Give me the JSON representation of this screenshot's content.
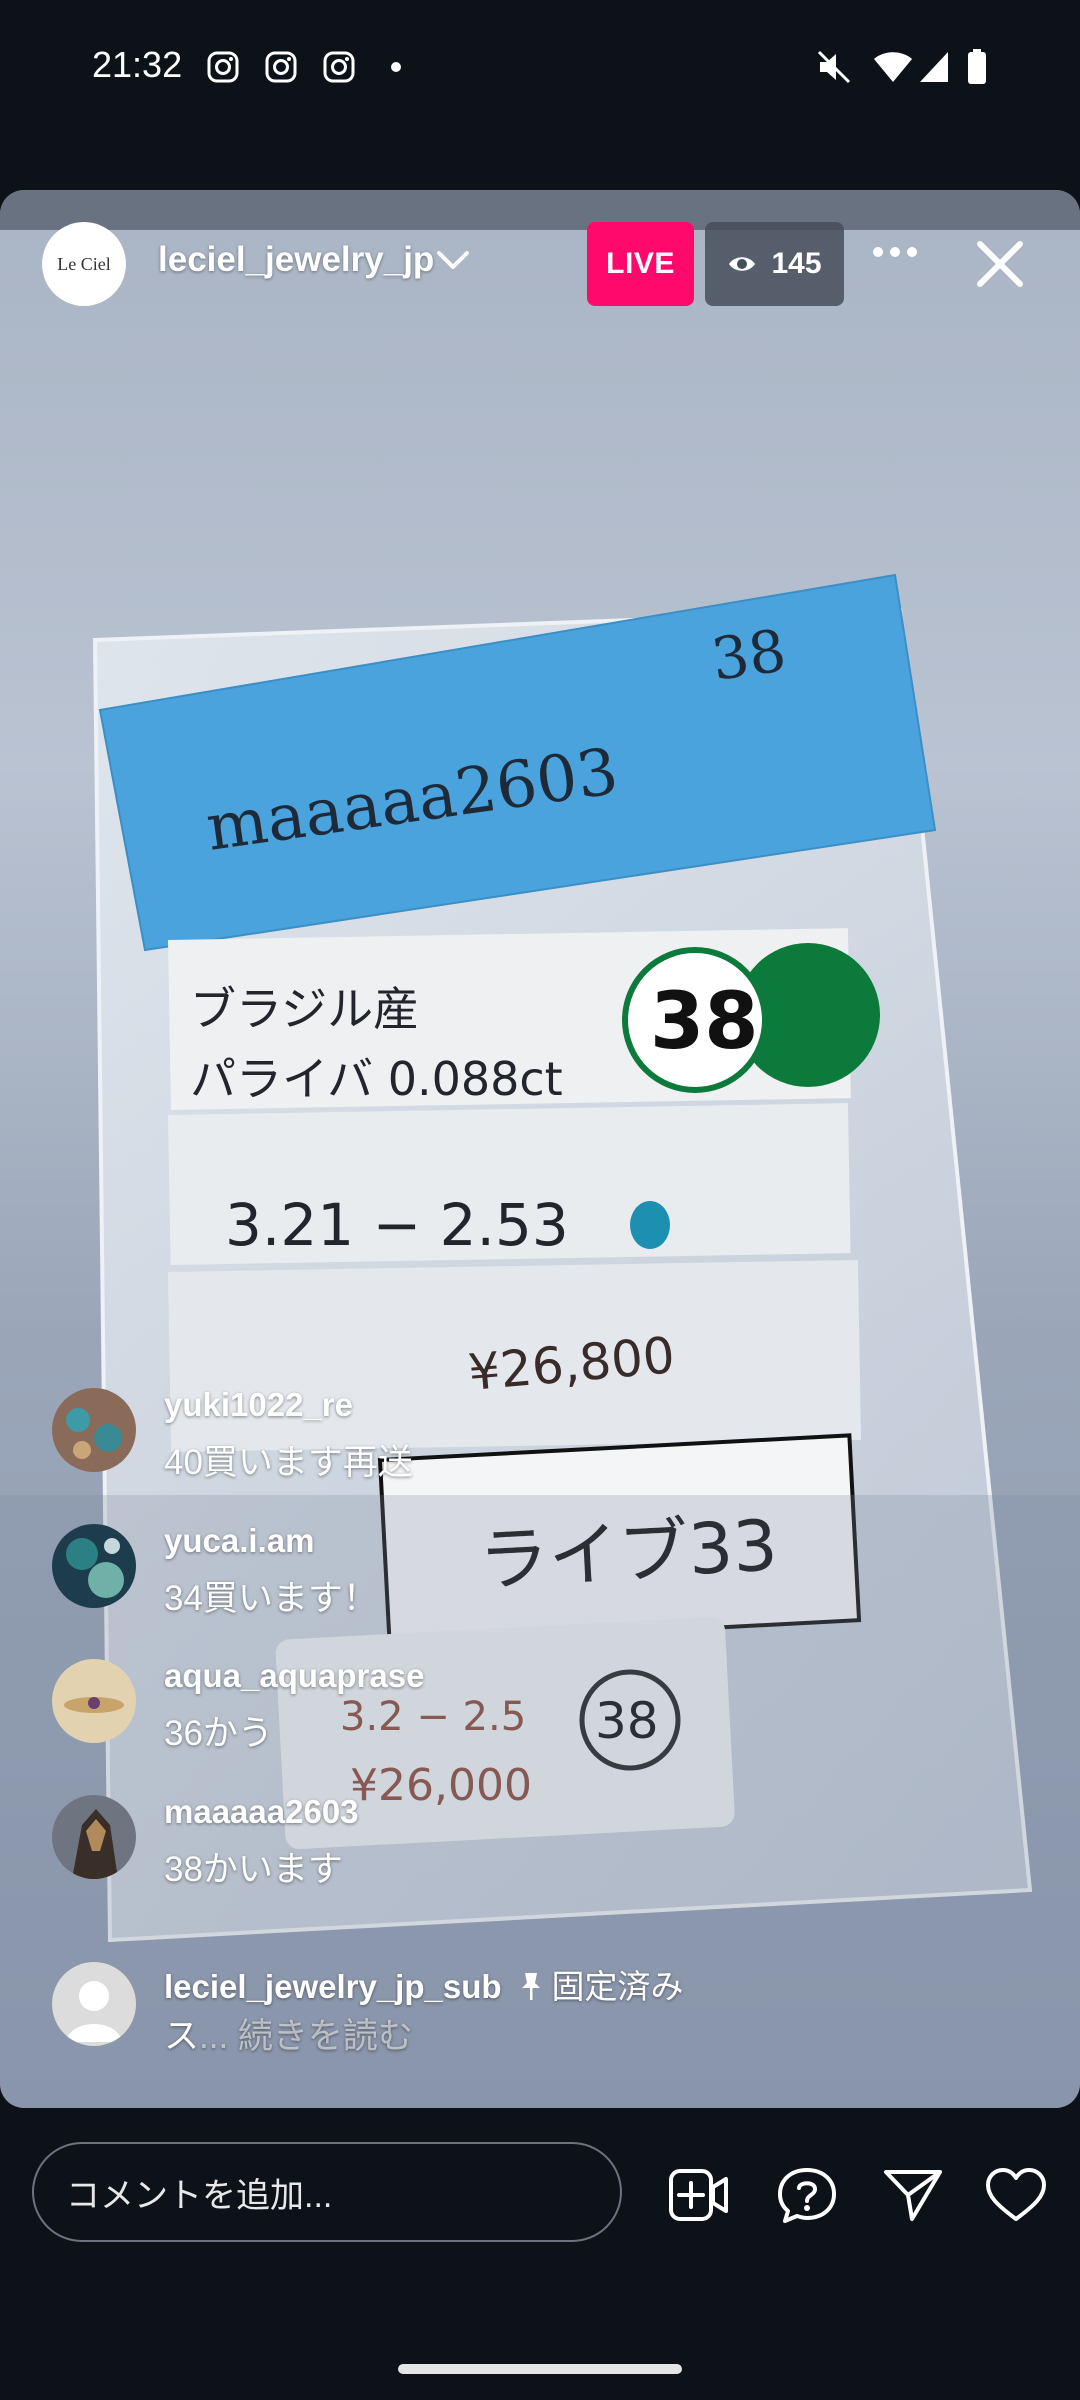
{
  "status_bar": {
    "time": "21:32",
    "icons": [
      "instagram-icon",
      "instagram-icon",
      "instagram-icon",
      "notification-dot",
      "mute-icon",
      "wifi-icon",
      "signal-icon",
      "battery-icon"
    ]
  },
  "live": {
    "username": "leciel_jewelry_jp",
    "avatar_text": "Le Ciel",
    "live_label": "LIVE",
    "viewer_count": "145"
  },
  "comments": [
    {
      "user": "yuki1022_re",
      "text": "40買います再送"
    },
    {
      "user": "yuca.i.am",
      "text": "34買います！"
    },
    {
      "user": "aqua_aquaprase",
      "text": "36かう"
    },
    {
      "user": "maaaaa2603",
      "text": "38かいます"
    }
  ],
  "pinned_comment": {
    "user": "leciel_jewelry_jp_sub",
    "pinned_label": "固定済み",
    "text": "ス",
    "read_more": "... 続きを読む"
  },
  "composer": {
    "placeholder": "コメントを追加..."
  },
  "colors": {
    "live_badge": "#ff0a6c",
    "background": "#0d1118"
  }
}
